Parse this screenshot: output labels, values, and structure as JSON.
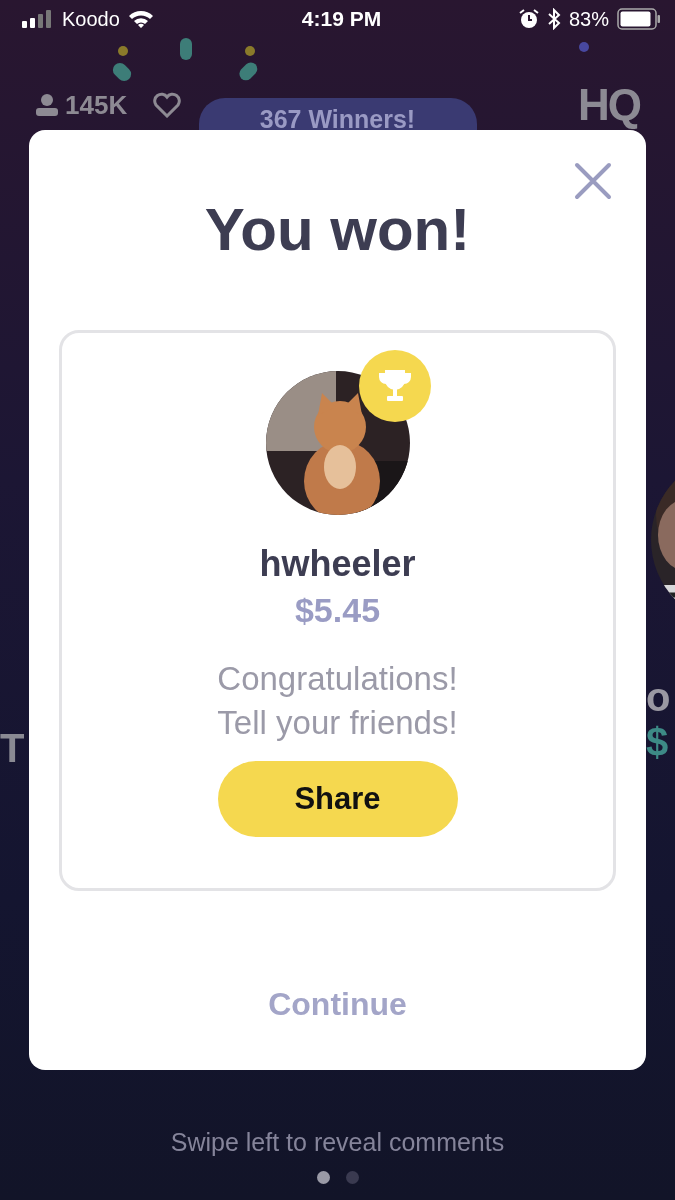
{
  "status_bar": {
    "carrier": "Koodo",
    "time": "4:19 PM",
    "battery": "83%"
  },
  "header": {
    "viewers": "145K",
    "logo": "HQ",
    "winners": "367 Winners!"
  },
  "carousel": {
    "left_card": {
      "name": "T"
    },
    "right_card": {
      "name": "o",
      "amount": "$"
    }
  },
  "modal": {
    "title": "You won!",
    "winner": {
      "username": "hwheeler",
      "amount": "$5.45"
    },
    "message": "Congratulations!\nTell your friends!",
    "share_button": "Share",
    "continue_button": "Continue"
  },
  "footer": {
    "hint": "Swipe left to reveal comments",
    "pages": [
      {
        "selected": true
      },
      {
        "selected": false
      }
    ]
  }
}
